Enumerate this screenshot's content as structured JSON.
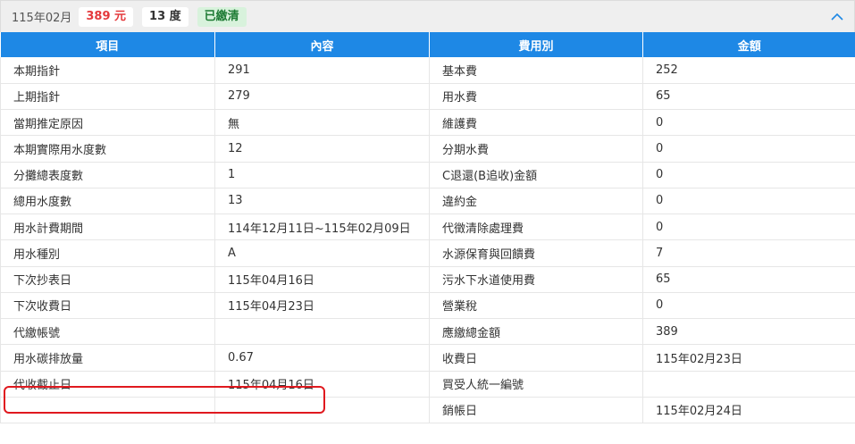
{
  "summary": {
    "period": "115年02月",
    "amount": "389 元",
    "usage": "13 度",
    "status": "已繳清"
  },
  "colors": {
    "header_bg": "#1e88e5",
    "amount_red": "#e4393c",
    "status_green_bg": "#d8f2dc",
    "status_green_text": "#1e7b34",
    "highlight_red": "#e0191f"
  },
  "toggle_icon": "chevron-up-icon",
  "table": {
    "headers": [
      "項目",
      "內容",
      "費用別",
      "金額"
    ],
    "rows": [
      [
        "本期指針",
        "291",
        "基本費",
        "252"
      ],
      [
        "上期指針",
        "279",
        "用水費",
        "65"
      ],
      [
        "當期推定原因",
        "無",
        "維護費",
        "0"
      ],
      [
        "本期實際用水度數",
        "12",
        "分期水費",
        "0"
      ],
      [
        "分攤總表度數",
        "1",
        "C退還(B追收)金額",
        "0"
      ],
      [
        "總用水度數",
        "13",
        "違約金",
        "0"
      ],
      [
        "用水計費期間",
        "114年12月11日~115年02月09日",
        "代徵清除處理費",
        "0"
      ],
      [
        "用水種別",
        "A",
        "水源保育與回饋費",
        "7"
      ],
      [
        "下次抄表日",
        "115年04月16日",
        "污水下水道使用費",
        "65"
      ],
      [
        "下次收費日",
        "115年04月23日",
        "營業稅",
        "0"
      ],
      [
        "代繳帳號",
        "",
        "應繳總金額",
        "389"
      ],
      [
        "用水碳排放量",
        "0.67",
        "收費日",
        "115年02月23日"
      ],
      [
        "代收截止日",
        "115年04月16日",
        "買受人統一編號",
        ""
      ],
      [
        "",
        "",
        "銷帳日",
        "115年02月24日"
      ]
    ]
  }
}
